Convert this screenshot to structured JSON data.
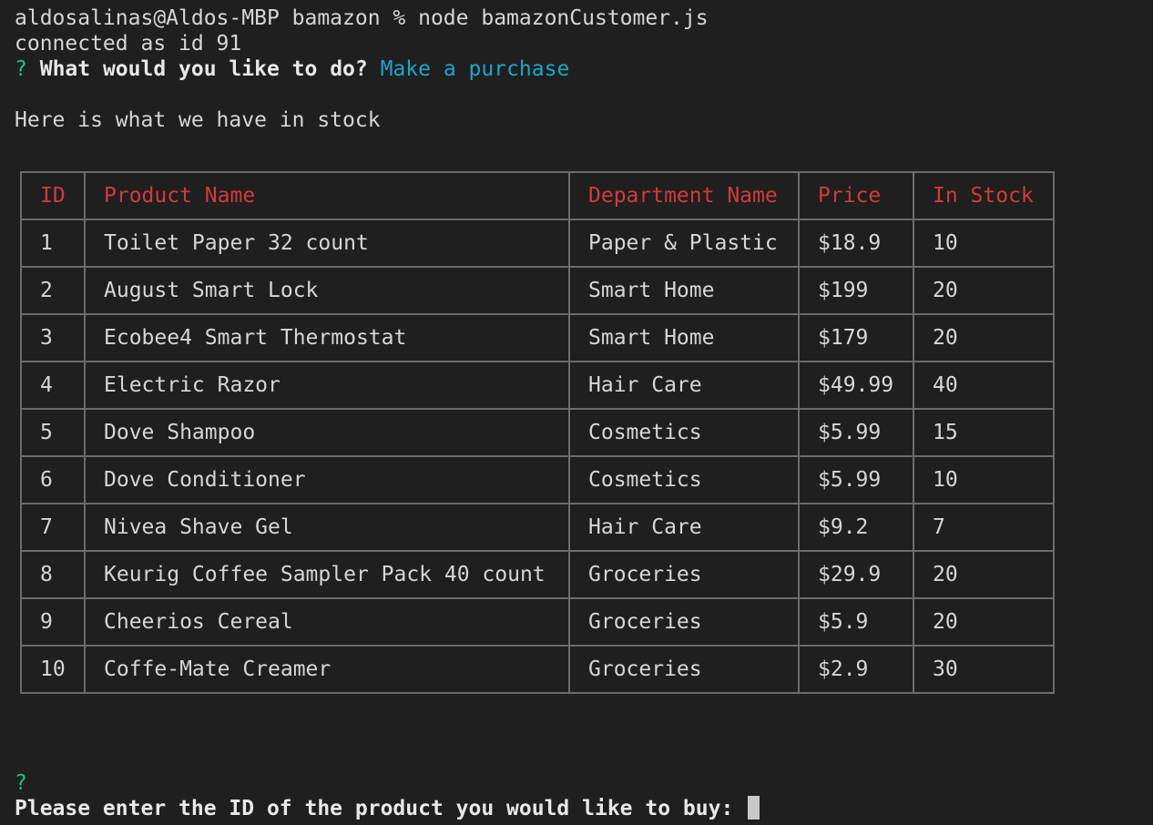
{
  "terminal": {
    "command_line": "aldosalinas@Aldos-MBP bamazon % node bamazonCustomer.js",
    "connection_line": "connected as id 91",
    "prompt1": {
      "marker": "?",
      "question": "What would you like to do?",
      "answer": "Make a purchase"
    },
    "stock_heading": "Here is what we have in stock",
    "prompt2": {
      "marker": "?",
      "question": "Please enter the ID of the product you would like to buy:"
    }
  },
  "table": {
    "headers": [
      "ID",
      "Product Name",
      "Department Name",
      "Price",
      "In Stock"
    ],
    "rows": [
      [
        "1",
        "Toilet Paper 32 count",
        "Paper & Plastic",
        "$18.9",
        "10"
      ],
      [
        "2",
        "August Smart Lock",
        "Smart Home",
        "$199",
        "20"
      ],
      [
        "3",
        "Ecobee4 Smart Thermostat",
        "Smart Home",
        "$179",
        "20"
      ],
      [
        "4",
        "Electric Razor",
        "Hair Care",
        "$49.99",
        "40"
      ],
      [
        "5",
        "Dove Shampoo",
        "Cosmetics",
        "$5.99",
        "15"
      ],
      [
        "6",
        "Dove Conditioner",
        "Cosmetics",
        "$5.99",
        "10"
      ],
      [
        "7",
        "Nivea Shave Gel",
        "Hair Care",
        "$9.2",
        "7"
      ],
      [
        "8",
        "Keurig Coffee Sampler Pack 40 count",
        "Groceries",
        "$29.9",
        "20"
      ],
      [
        "9",
        "Cheerios Cereal",
        "Groceries",
        "$5.9",
        "20"
      ],
      [
        "10",
        "Coffe-Mate Creamer",
        "Groceries",
        "$2.9",
        "30"
      ]
    ]
  },
  "colors": {
    "background": "#1f1f1f",
    "header_text": "#d43a3a",
    "prompt_marker": "#19c37d",
    "answer_text": "#1aa7c7"
  }
}
